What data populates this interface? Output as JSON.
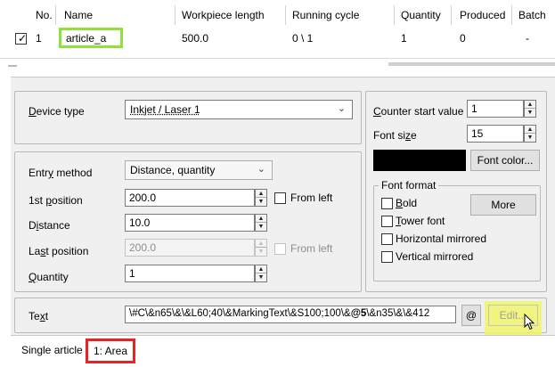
{
  "table": {
    "columns": [
      "No.",
      "Name",
      "Workpiece length",
      "Running cycle",
      "Quantity",
      "Produced",
      "Batch"
    ],
    "row": {
      "checked": true,
      "check_glyph": "✓",
      "no": "1",
      "name": "article_a",
      "workpiece_length": "500.0",
      "running_cycle": "0 \\ 1",
      "quantity": "1",
      "produced": "0",
      "batch": "-"
    }
  },
  "form": {
    "device_type": {
      "label_acc": "D",
      "label_rest": "evice type",
      "value": "Inkjet / Laser 1"
    },
    "counter_start": {
      "label_acc": "C",
      "label_rest": "ounter start value",
      "value": "1"
    },
    "font_size": {
      "label_pre": "Font si",
      "label_acc": "z",
      "label_rest": "e",
      "value": "15"
    },
    "font_color_button": "Font color...",
    "entry_method": {
      "label_pre": "Entr",
      "label_acc": "y",
      "label_rest": " method",
      "value": "Distance, quantity"
    },
    "first_position": {
      "label_pre": "1st ",
      "label_acc": "p",
      "label_rest": "osition",
      "value": "200.0",
      "from_left": "From left"
    },
    "distance": {
      "label_pre": "D",
      "label_acc": "i",
      "label_rest": "stance",
      "value": "10.0"
    },
    "last_position": {
      "label_pre": "La",
      "label_acc": "s",
      "label_rest": "t position",
      "value": "200.0",
      "from_left": "From left"
    },
    "quantity": {
      "label_acc": "Q",
      "label_rest": "uantity",
      "value": "1"
    },
    "font_format": {
      "title": "Font format",
      "bold": {
        "acc": "B",
        "rest": "old"
      },
      "tower": {
        "acc": "T",
        "rest": "ower font"
      },
      "horizontal": "Horizontal mirrored",
      "vertical": "Vertical mirrored",
      "more_button": "More"
    },
    "text": {
      "label_pre": "Te",
      "label_acc": "x",
      "label_rest": "t",
      "value_pre": "\\#C\\&n65\\&\\&L60;40\\&MarkingText\\&S100;100\\&",
      "value_bold": "@5",
      "value_post": "\\&n35\\&\\&412",
      "at_button": "@",
      "edit_button": "Edit..."
    }
  },
  "tabs": [
    "Single article",
    "1: Area"
  ],
  "colors": {
    "name_highlight": "#8ee23a",
    "tab_highlight": "#e52323",
    "edit_highlight": "#f1f46a",
    "font_color": "#000000"
  }
}
